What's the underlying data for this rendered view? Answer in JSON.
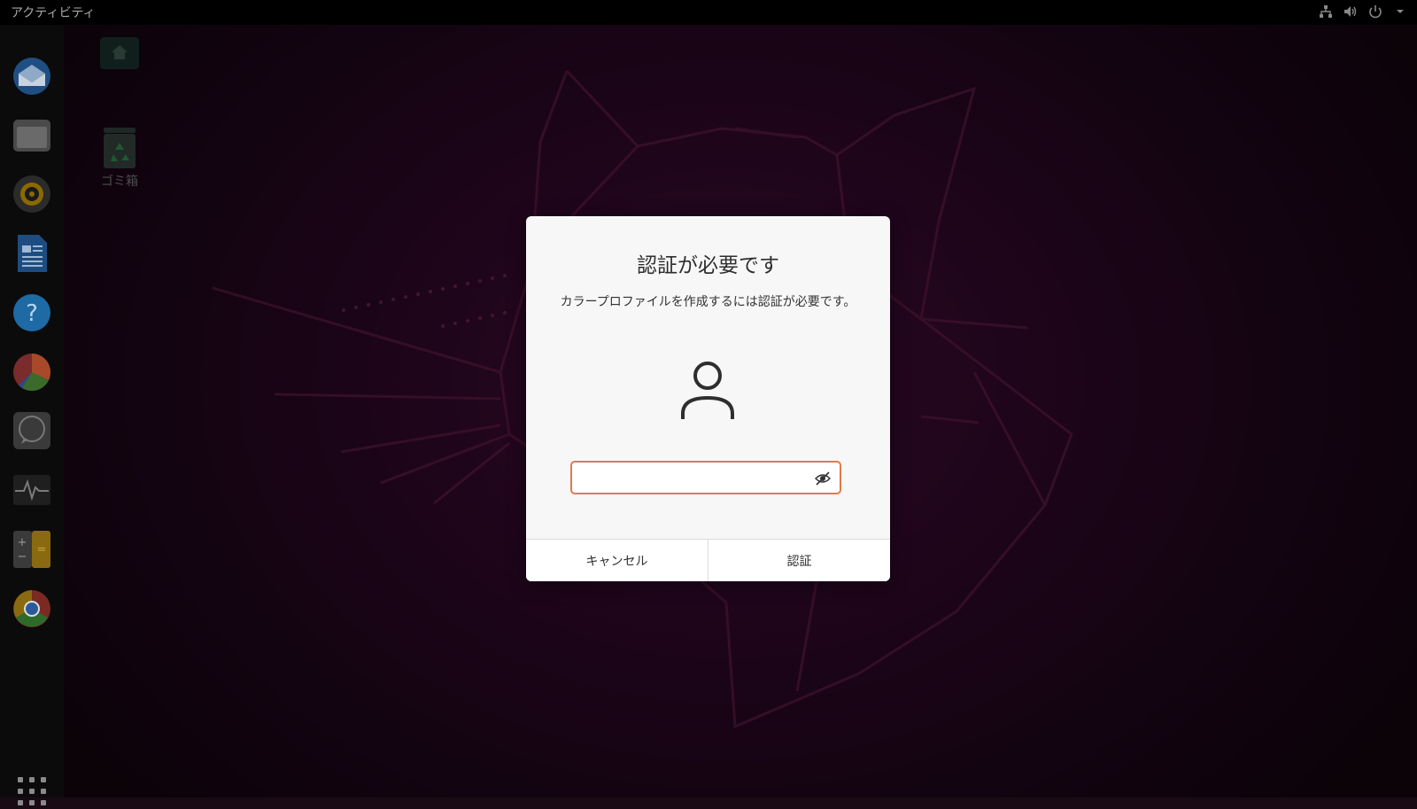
{
  "topbar": {
    "activities_label": "アクティビティ",
    "tray_icons": [
      "network-icon",
      "volume-icon",
      "power-icon",
      "chevron-down-icon"
    ]
  },
  "dock": {
    "items": [
      {
        "icon": "thunderbird-icon"
      },
      {
        "icon": "files-icon"
      },
      {
        "icon": "rhythmbox-icon"
      },
      {
        "icon": "libreoffice-writer-icon"
      },
      {
        "icon": "help-icon"
      },
      {
        "icon": "chart-app-icon"
      },
      {
        "icon": "chat-icon"
      },
      {
        "icon": "system-monitor-icon"
      },
      {
        "icon": "calculator-icon"
      },
      {
        "icon": "chrome-icon"
      }
    ],
    "show_apps_icon": "grid-icon"
  },
  "desktop": {
    "icons": [
      {
        "icon": "home-folder-icon",
        "label": ""
      },
      {
        "icon": "trash-icon",
        "label": "ゴミ箱"
      }
    ]
  },
  "dialog": {
    "title": "認証が必要です",
    "message": "カラープロファイルを作成するには認証が必要です。",
    "password": {
      "value": "",
      "placeholder": ""
    },
    "cancel_label": "キャンセル",
    "authenticate_label": "認証",
    "accent_color": "#e07a4d"
  }
}
